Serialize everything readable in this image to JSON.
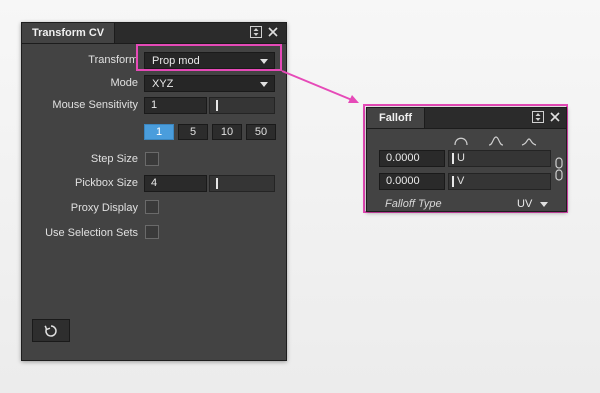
{
  "transform_panel": {
    "title": "Transform CV",
    "transform_label": "Transform",
    "transform_value": "Prop mod",
    "mode_label": "Mode",
    "mode_value": "XYZ",
    "mouse_sensitivity_label": "Mouse Sensitivity",
    "mouse_sensitivity_value": "1",
    "sensitivity_presets": [
      "1",
      "5",
      "10",
      "50"
    ],
    "step_size_label": "Step Size",
    "pickbox_size_label": "Pickbox Size",
    "pickbox_size_value": "4",
    "proxy_display_label": "Proxy Display",
    "use_selection_sets_label": "Use Selection Sets"
  },
  "falloff_panel": {
    "title": "Falloff",
    "u_value": "0.0000",
    "u_label": "U",
    "v_value": "0.0000",
    "v_label": "V",
    "falloff_type_label": "Falloff Type",
    "falloff_type_value": "UV"
  },
  "colors": {
    "panel_bg": "#434343",
    "highlight": "#e64ab8",
    "active_button": "#4a9ddc"
  }
}
